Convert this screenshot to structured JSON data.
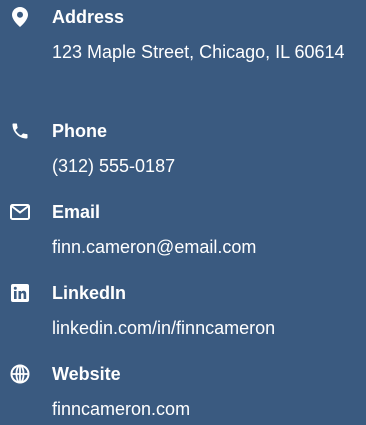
{
  "contact": {
    "items": [
      {
        "icon": "map-marker-icon",
        "label": "Address",
        "value": "123 Maple Street, Chicago, IL 60614"
      },
      {
        "icon": "phone-icon",
        "label": "Phone",
        "value": "(312) 555-0187"
      },
      {
        "icon": "envelope-icon",
        "label": "Email",
        "value": "finn.cameron@email.com"
      },
      {
        "icon": "linkedin-icon",
        "label": "LinkedIn",
        "value": "linkedin.com/in/finncameron"
      },
      {
        "icon": "globe-icon",
        "label": "Website",
        "value": "finncameron.com"
      }
    ]
  }
}
